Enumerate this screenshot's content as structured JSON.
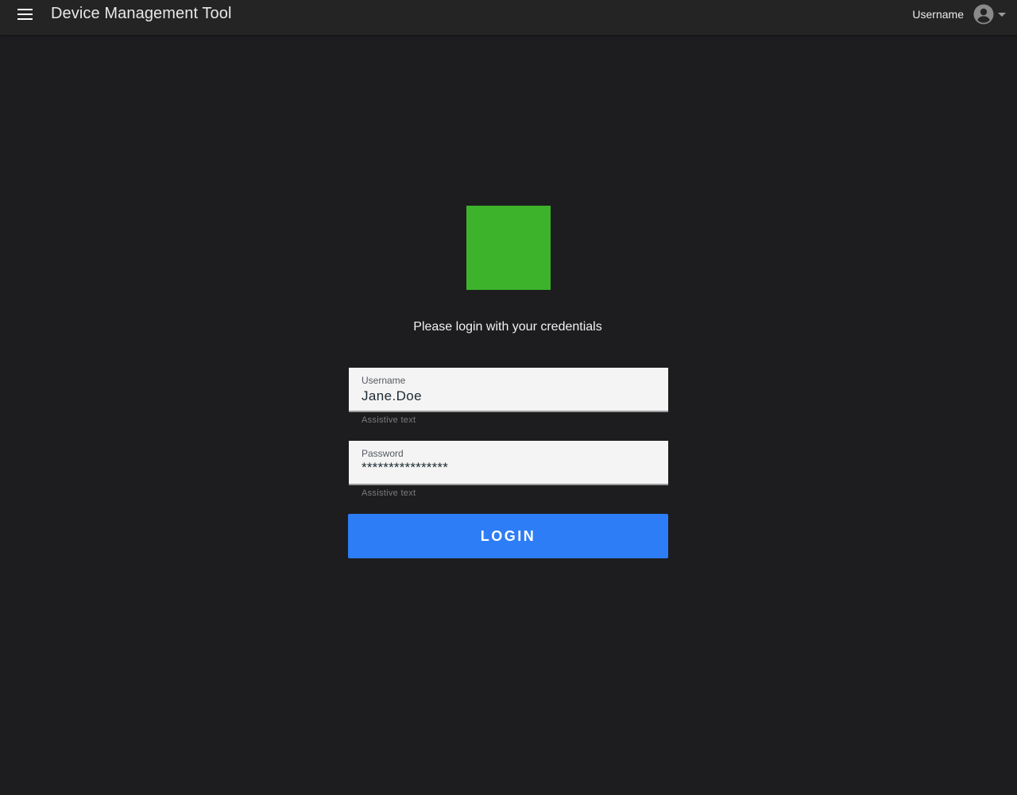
{
  "header": {
    "title": "Device Management Tool",
    "menu_icon": "hamburger-menu-icon",
    "username": "Username",
    "avatar_icon": "account-circle-icon",
    "dropdown_icon": "caret-down-icon"
  },
  "logo": {
    "color": "#3db32c"
  },
  "login": {
    "prompt": "Please login with your credentials",
    "username_label": "Username",
    "username_value": "Jane.Doe",
    "username_assistive": "Assistive text",
    "password_label": "Password",
    "password_value": "****************",
    "password_assistive": "Assistive text",
    "submit_label": "LOGIN"
  },
  "colors": {
    "background": "#1d1d1f",
    "appbar": "#242424",
    "primary": "#2d7df6",
    "field_background": "#f4f4f4"
  }
}
